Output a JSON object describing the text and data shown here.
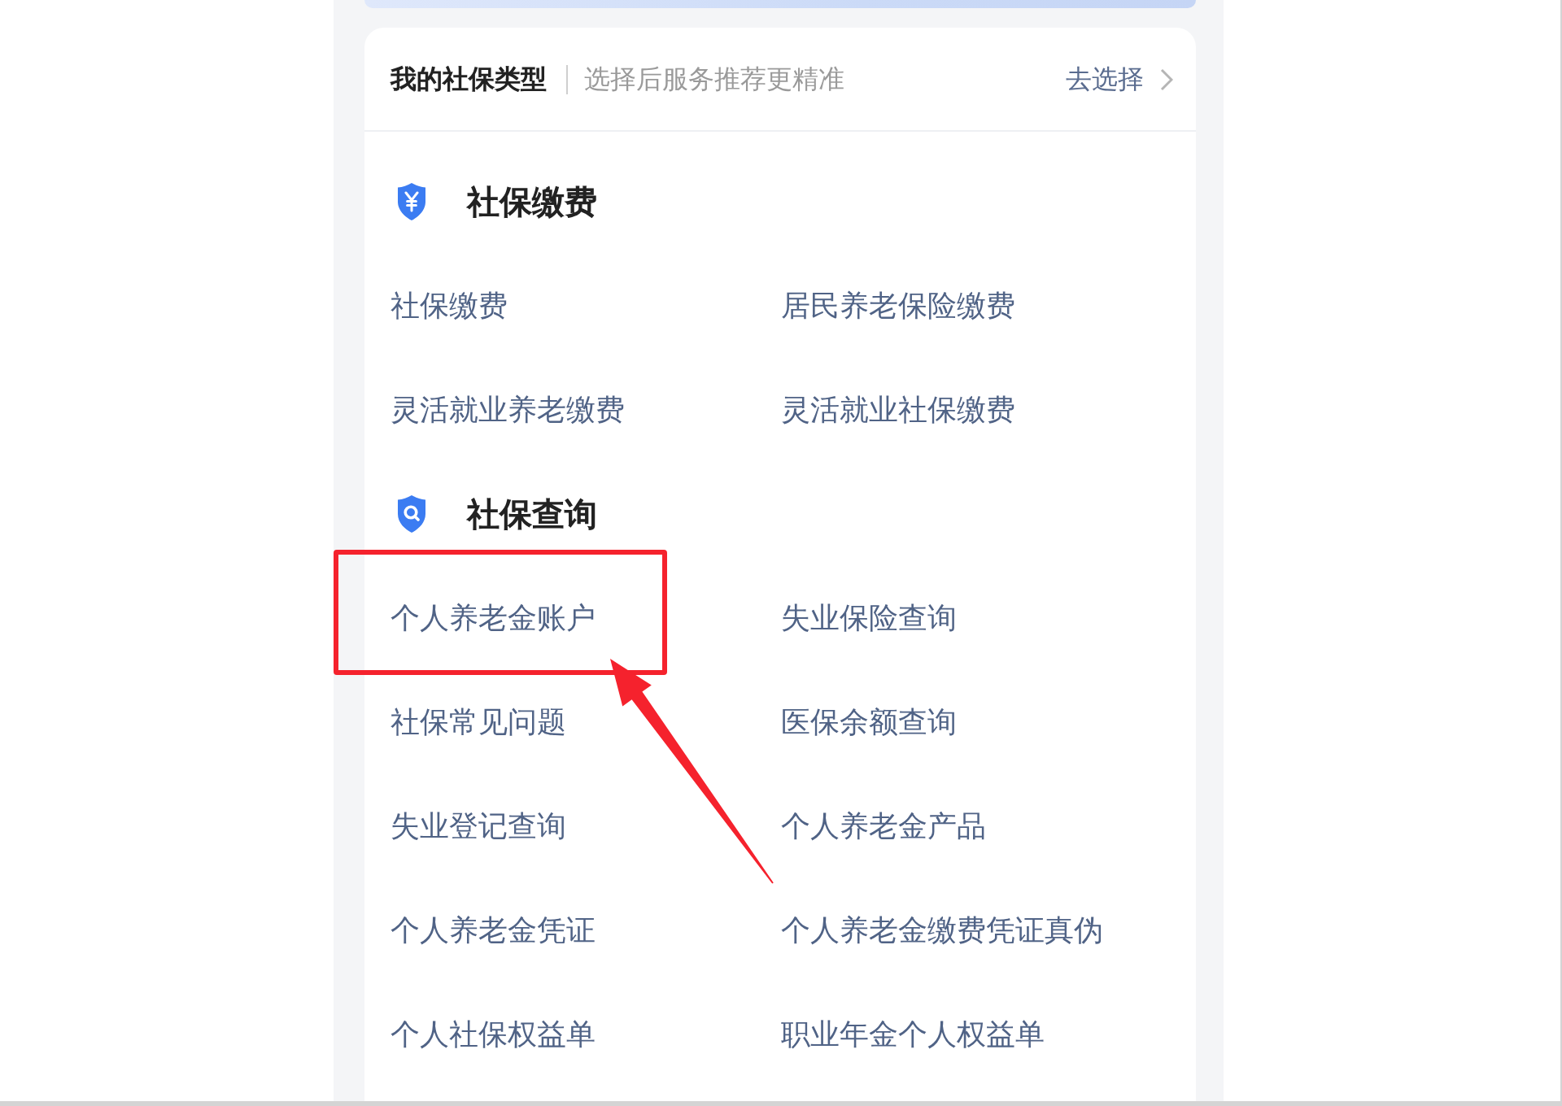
{
  "header": {
    "title": "我的社保类型",
    "hint": "选择后服务推荐更精准",
    "action": "去选择"
  },
  "sections": [
    {
      "kind": "payment",
      "title": "社保缴费",
      "items": [
        {
          "label": "社保缴费",
          "highlighted": false
        },
        {
          "label": "居民养老保险缴费",
          "highlighted": false
        },
        {
          "label": "灵活就业养老缴费",
          "highlighted": false
        },
        {
          "label": "灵活就业社保缴费",
          "highlighted": false
        }
      ]
    },
    {
      "kind": "query",
      "title": "社保查询",
      "items": [
        {
          "label": "个人养老金账户",
          "highlighted": true
        },
        {
          "label": "失业保险查询",
          "highlighted": false
        },
        {
          "label": "社保常见问题",
          "highlighted": false
        },
        {
          "label": "医保余额查询",
          "highlighted": false
        },
        {
          "label": "失业登记查询",
          "highlighted": false
        },
        {
          "label": "个人养老金产品",
          "highlighted": false
        },
        {
          "label": "个人养老金凭证",
          "highlighted": false
        },
        {
          "label": "个人养老金缴费凭证真伪",
          "highlighted": false
        },
        {
          "label": "个人社保权益单",
          "highlighted": false
        },
        {
          "label": "职业年金个人权益单",
          "highlighted": false
        }
      ]
    }
  ]
}
